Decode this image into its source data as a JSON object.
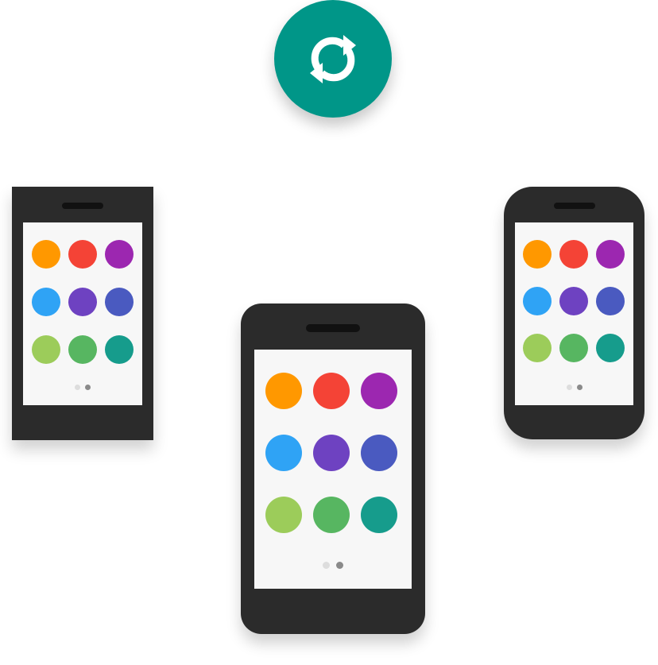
{
  "colors": {
    "accent": "#009688",
    "phone_body": "#2b2b2b",
    "screen": "#f7f7f7",
    "pager_inactive": "#dddddd",
    "pager_active": "#8a8a8a"
  },
  "sync_badge": {
    "icon": "sync-icon"
  },
  "app_icon_colors": [
    "#FF9800",
    "#F44336",
    "#9C27B0",
    "#2FA3F5",
    "#6E42C1",
    "#4A5AC0",
    "#9CCC5A",
    "#57B661",
    "#169C8C"
  ],
  "phones": [
    {
      "id": "left",
      "shape": "square"
    },
    {
      "id": "center",
      "shape": "rounded"
    },
    {
      "id": "right",
      "shape": "rounded"
    }
  ],
  "pager": {
    "page_count": 2,
    "active_page": 2
  }
}
